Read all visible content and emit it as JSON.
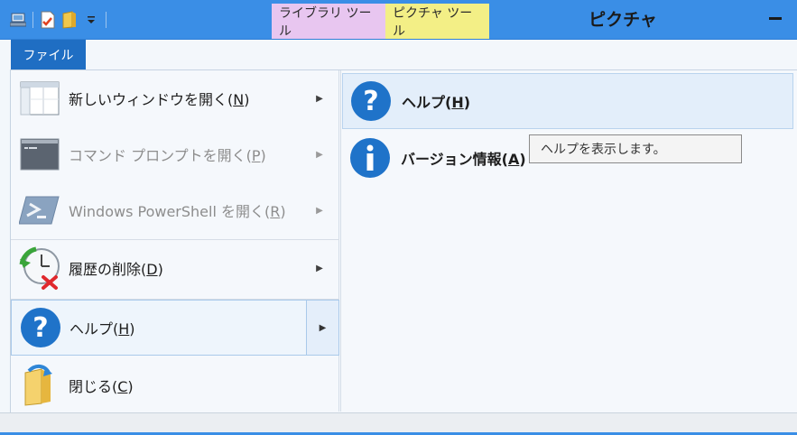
{
  "window": {
    "title": "ピクチャ",
    "context_tabs": [
      {
        "label": "ライブラリ ツール",
        "color": "#e8c6f0"
      },
      {
        "label": "ピクチャ ツール",
        "color": "#f3ef86"
      }
    ],
    "accent": "#3a8ee6"
  },
  "quick_access": {
    "icons": [
      "properties-icon",
      "new-folder-check-icon",
      "folder-icon",
      "customize-dropdown-icon"
    ]
  },
  "file_tab": {
    "label": "ファイル",
    "color": "#1f6ec3"
  },
  "menu": {
    "items": [
      {
        "text": "新しいウィンドウを開く(",
        "key": "N",
        "close": ")",
        "icon": "new-window-icon",
        "disabled": false,
        "submenu": true
      },
      {
        "text": "コマンド プロンプトを開く(",
        "key": "P",
        "close": ")",
        "icon": "command-prompt-icon",
        "disabled": true,
        "submenu": true
      },
      {
        "text": "Windows PowerShell を開く(",
        "key": "R",
        "close": ")",
        "icon": "powershell-icon",
        "disabled": true,
        "submenu": true
      },
      {
        "text": "履歴の削除(",
        "key": "D",
        "close": ")",
        "icon": "clear-history-icon",
        "disabled": false,
        "submenu": true
      },
      {
        "text": "ヘルプ(",
        "key": "H",
        "close": ")",
        "icon": "help-icon",
        "disabled": false,
        "submenu": true,
        "selected": true
      },
      {
        "text": "閉じる(",
        "key": "C",
        "close": ")",
        "icon": "close-icon",
        "disabled": false,
        "submenu": false
      }
    ]
  },
  "submenu": {
    "items": [
      {
        "text": "ヘルプ(",
        "key": "H",
        "close": ")",
        "icon": "help-icon"
      },
      {
        "text": "バージョン情報(",
        "key": "A",
        "close": ")",
        "icon": "info-icon"
      }
    ]
  },
  "tooltip": {
    "text": "ヘルプを表示します。"
  }
}
